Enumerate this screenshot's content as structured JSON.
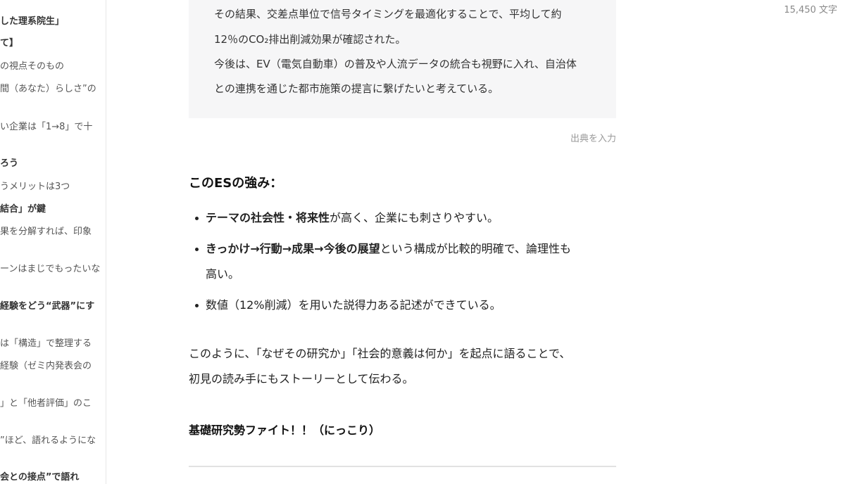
{
  "toc": [
    {
      "text": "した理系院生」",
      "bold": true
    },
    {
      "text": "て】",
      "bold": true
    },
    {
      "text": "の視点そのもの",
      "bold": false
    },
    {
      "text": "間（あなた）らしさ”の",
      "bold": false
    },
    {
      "text": "い企業は「1→8」で十",
      "bold": false
    },
    {
      "text": "ろう",
      "bold": true
    },
    {
      "text": "うメリットは3つ",
      "bold": false
    },
    {
      "text": "結合」が鍵",
      "bold": true
    },
    {
      "text": "果を分解すれば、印象",
      "bold": false
    },
    {
      "text": "ーンはまじでもったいな",
      "bold": false
    },
    {
      "text": "経験をどう“武器”にす",
      "bold": true
    },
    {
      "text": "は「構造」で整理する",
      "bold": false
    },
    {
      "text": "経験（ゼミ内発表会の",
      "bold": false
    },
    {
      "text": "」と「他者評価」のこ",
      "bold": false
    },
    {
      "text": "”ほど、語れるようにな",
      "bold": false
    },
    {
      "text": "会との接点”で語れ",
      "bold": true
    }
  ],
  "char_count": "15,450 文字",
  "quote": {
    "line1": "その結果、交差点単位で信号タイミングを最適化することで、平均して約",
    "line2": "12％のCO₂排出削減効果が確認された。",
    "line3": "今後は、EV（電気自動車）の普及や人流データの統合も視野に入れ、自治体",
    "line4": "との連携を通じた都市施策の提言に繋げたいと考えている。"
  },
  "citation_placeholder": "出典を入力",
  "strengths_heading": "このESの強み：",
  "bullets": {
    "b1_bold": "テーマの社会性・将来性",
    "b1_rest": "が高く、企業にも刺さりやすい。",
    "b2_bold": "きっかけ→行動→成果→今後の展望",
    "b2_rest": "という構成が比較的明確で、論理性も",
    "b2_cont": "高い。",
    "b3": "数値（12%削減）を用いた説得力ある記述ができている。"
  },
  "paragraph": {
    "line1": "このように、「なぜその研究か」「社会的意義は何か」を起点に語ることで、",
    "line2": "初見の読み手にもストーリーとして伝わる。"
  },
  "closing": "基礎研究勢ファイト！！（にっこり）"
}
